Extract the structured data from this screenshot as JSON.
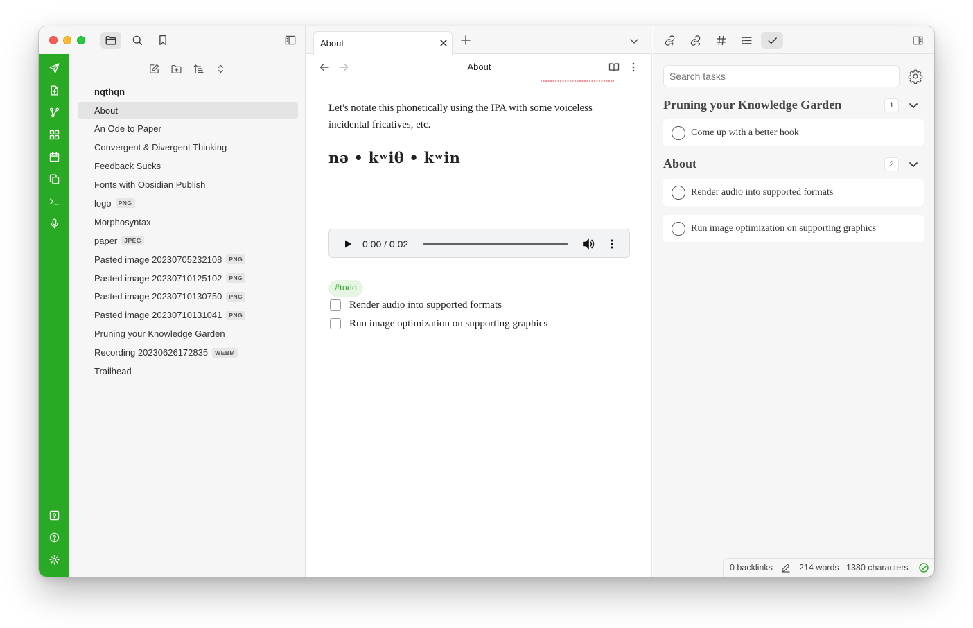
{
  "window": {
    "traffic_lights": [
      "close",
      "minimize",
      "zoom"
    ]
  },
  "left_top_icons": [
    "folder-icon",
    "search-icon",
    "bookmark-icon",
    "sidebar-toggle-icon"
  ],
  "ribbon": {
    "color": "#2aaa24",
    "top_icons": [
      "send-icon",
      "file-plus-icon",
      "graph-icon",
      "layout-grid-icon",
      "calendar-icon",
      "copy-icon",
      "terminal-icon",
      "mic-icon"
    ],
    "bottom_icons": [
      "vault-icon",
      "help-icon",
      "settings-icon"
    ]
  },
  "explorer": {
    "actions": [
      "new-note-icon",
      "new-folder-icon",
      "sort-icon",
      "collapse-icon"
    ],
    "vault_name": "nqthqn",
    "files": [
      {
        "name": "About",
        "ext": "",
        "active": true
      },
      {
        "name": "An Ode to Paper",
        "ext": ""
      },
      {
        "name": "Convergent & Divergent Thinking",
        "ext": ""
      },
      {
        "name": "Feedback Sucks",
        "ext": ""
      },
      {
        "name": "Fonts with Obsidian Publish",
        "ext": ""
      },
      {
        "name": "logo",
        "ext": "PNG"
      },
      {
        "name": "Morphosyntax",
        "ext": ""
      },
      {
        "name": "paper",
        "ext": "JPEG"
      },
      {
        "name": "Pasted image 20230705232108",
        "ext": "PNG"
      },
      {
        "name": "Pasted image 20230710125102",
        "ext": "PNG"
      },
      {
        "name": "Pasted image 20230710130750",
        "ext": "PNG"
      },
      {
        "name": "Pasted image 20230710131041",
        "ext": "PNG"
      },
      {
        "name": "Pruning your Knowledge Garden",
        "ext": ""
      },
      {
        "name": "Recording 20230626172835",
        "ext": "WEBM"
      },
      {
        "name": "Trailhead",
        "ext": ""
      }
    ]
  },
  "tabs": {
    "active_tab": "About"
  },
  "view_header": {
    "title": "About"
  },
  "note": {
    "paragraph": "Let's notate this phonetically using the IPA with some voiceless incidental fricatives, etc.",
    "ipa": "nə • kʷiθ • kʷin",
    "audio": {
      "time": "0:00 / 0:02",
      "progress": 0
    },
    "tag": "#todo",
    "tasks": [
      {
        "label": "Render audio into supported formats",
        "checked": false
      },
      {
        "label": "Run image optimization on supporting graphics",
        "checked": false
      }
    ]
  },
  "right_top_icons": [
    "backlinks-icon",
    "outgoing-links-icon",
    "tags-icon",
    "outline-icon",
    "tasks-check-icon",
    "right-sidebar-toggle-icon"
  ],
  "tasks_panel": {
    "search_placeholder": "Search tasks",
    "groups": [
      {
        "title": "Pruning your Knowledge Garden",
        "count": "1",
        "tasks": [
          "Come up with a better hook"
        ]
      },
      {
        "title": "About",
        "count": "2",
        "tasks": [
          "Render audio into supported formats",
          "Run image optimization on supporting graphics"
        ]
      }
    ]
  },
  "status_bar": {
    "backlinks": "0 backlinks",
    "words": "214 words",
    "characters": "1380 characters",
    "sync_color": "#2aaa24"
  }
}
